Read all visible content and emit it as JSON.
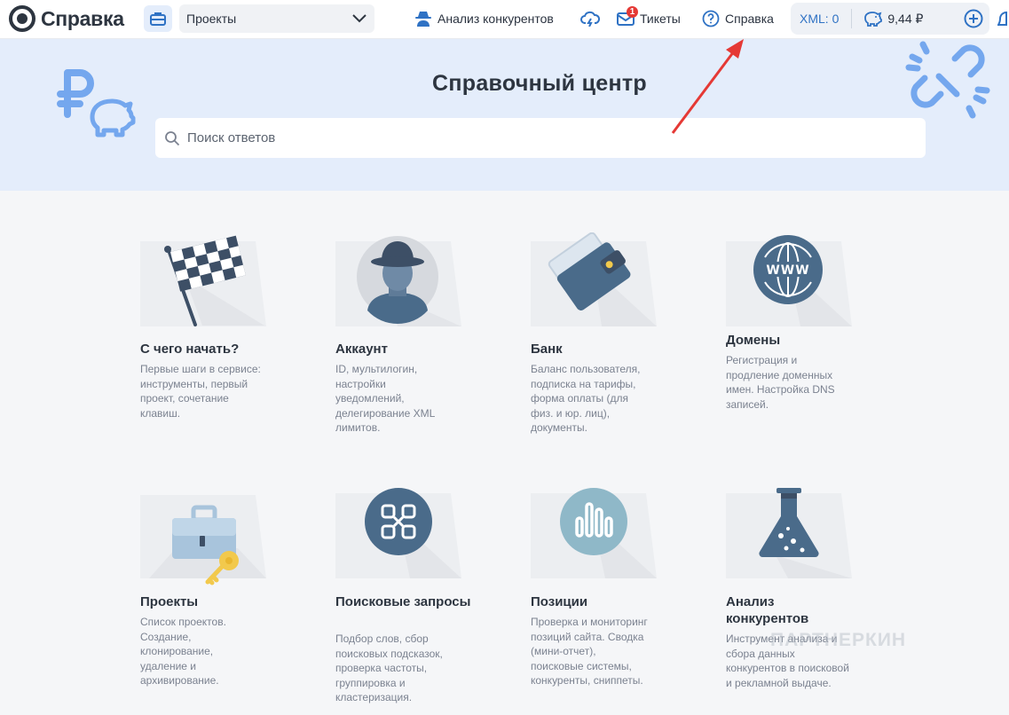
{
  "header": {
    "logo_text": "Справка",
    "project_select_value": "Проекты",
    "nav": {
      "competitors": "Анализ конкурентов",
      "tickets": "Тикеты",
      "tickets_badge": "1",
      "help": "Справка"
    },
    "xml": "XML: 0",
    "balance": "9,44 ₽"
  },
  "hero": {
    "title": "Справочный центр",
    "search_placeholder": "Поиск ответов"
  },
  "categories": [
    {
      "title": "С чего начать?",
      "description": "Первые шаги в сервисе: инструменты, первый проект, сочетание клавиш."
    },
    {
      "title": "Аккаунт",
      "description": "ID, мультилогин, настройки уведомлений, делегирование XML лимитов."
    },
    {
      "title": "Банк",
      "description": "Баланс пользователя, подписка на тарифы, форма оплаты (для физ. и юр. лиц), документы."
    },
    {
      "title": "Домены",
      "description": "Регистрация и продление доменных имен. Настройка DNS записей."
    },
    {
      "title": "Проекты",
      "description": "Список проектов. Создание, клонирование, удаление и архивирование."
    },
    {
      "title": "Поисковые запросы",
      "description": "Подбор слов, сбор поисковых подсказок, проверка частоты, группировка и кластеризация."
    },
    {
      "title": "Позиции",
      "description": "Проверка и мониторинг позиций сайта. Сводка (мини-отчет), поисковые системы, конкуренты, сниппеты."
    },
    {
      "title": "Анализ конкурентов",
      "description": "Инструмент анализа и сбора данных конкурентов в поисковой и рекламной выдаче."
    }
  ],
  "watermark": "ПАРТНЕРКИН",
  "colors": {
    "accent": "#2f72c4",
    "hero_bg": "#e4edfb",
    "page_bg": "#f5f6f8",
    "icon_slate": "#4a6b8a",
    "badge_red": "#e53935",
    "arrow_red": "#e53935"
  }
}
